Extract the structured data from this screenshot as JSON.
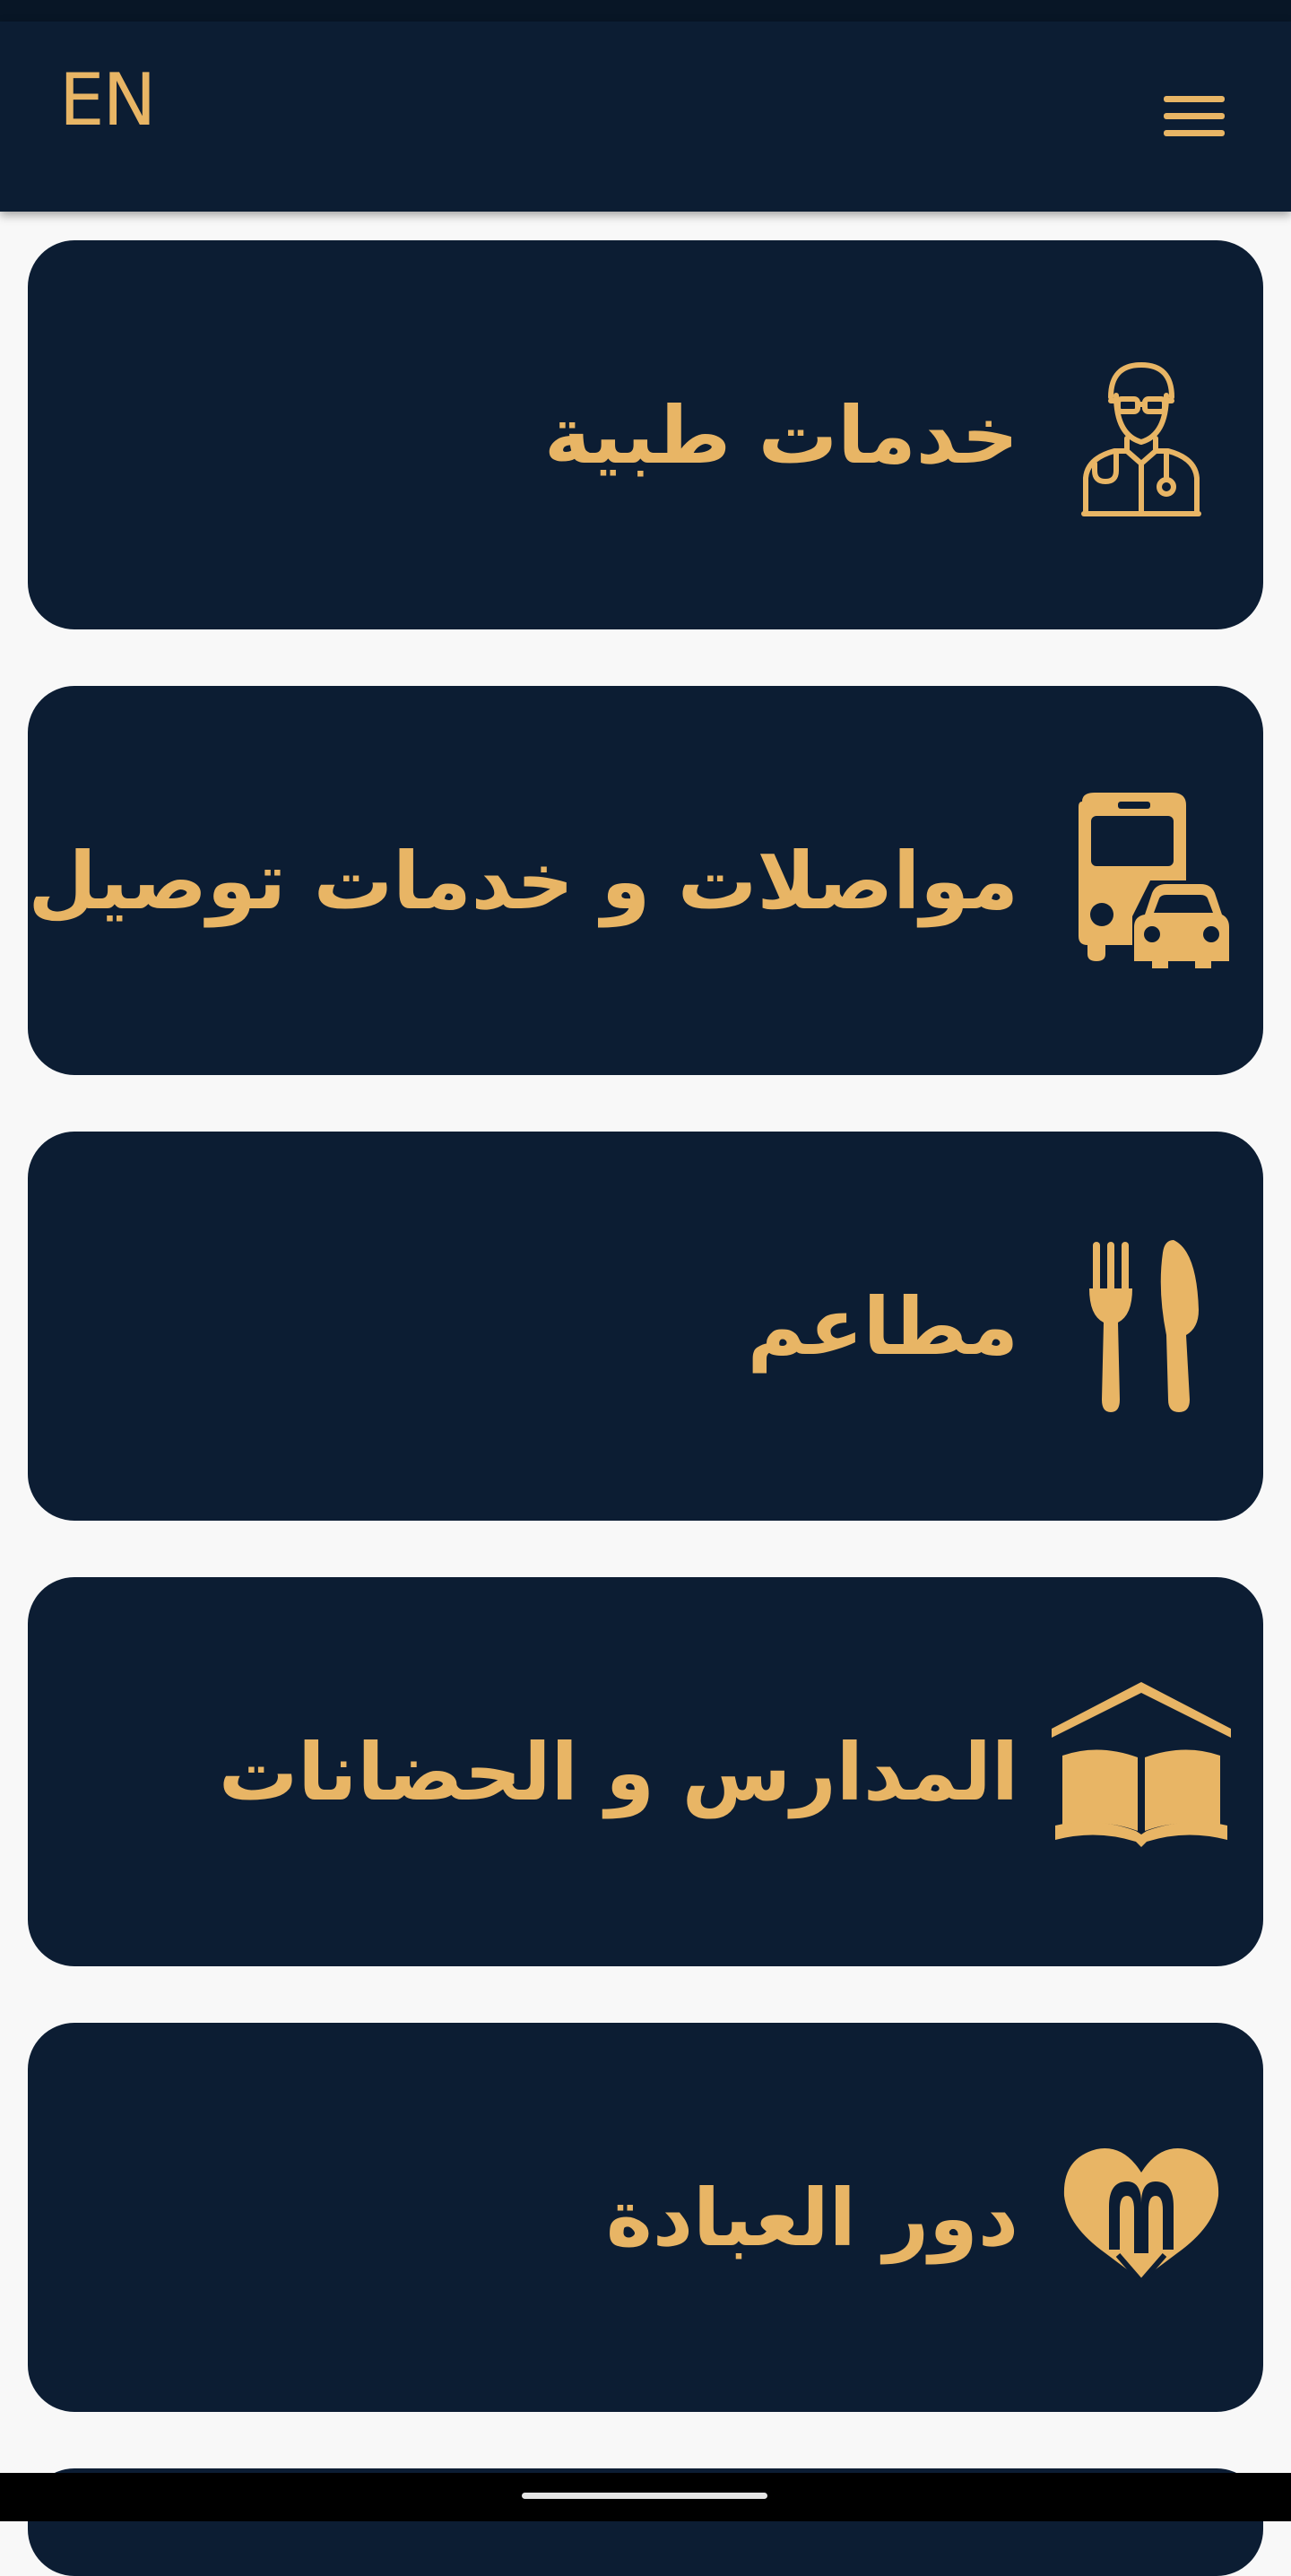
{
  "header": {
    "language_toggle": "EN",
    "menu_icon": "hamburger-menu-icon"
  },
  "cards": [
    {
      "label": "خدمات طبية",
      "icon": "doctor-icon"
    },
    {
      "label": "مواصلات و خدمات توصيل",
      "icon": "bus-car-icon"
    },
    {
      "label": "مطاعم",
      "icon": "fork-knife-icon"
    },
    {
      "label": "المدارس و الحضانات",
      "icon": "book-house-icon"
    },
    {
      "label": "دور العبادة",
      "icon": "heart-hands-icon"
    }
  ],
  "colors": {
    "background": "#f8f8f8",
    "card": "#0c1d33",
    "accent": "#e8b565",
    "status_bar": "#081626",
    "nav_bar": "#000000"
  }
}
